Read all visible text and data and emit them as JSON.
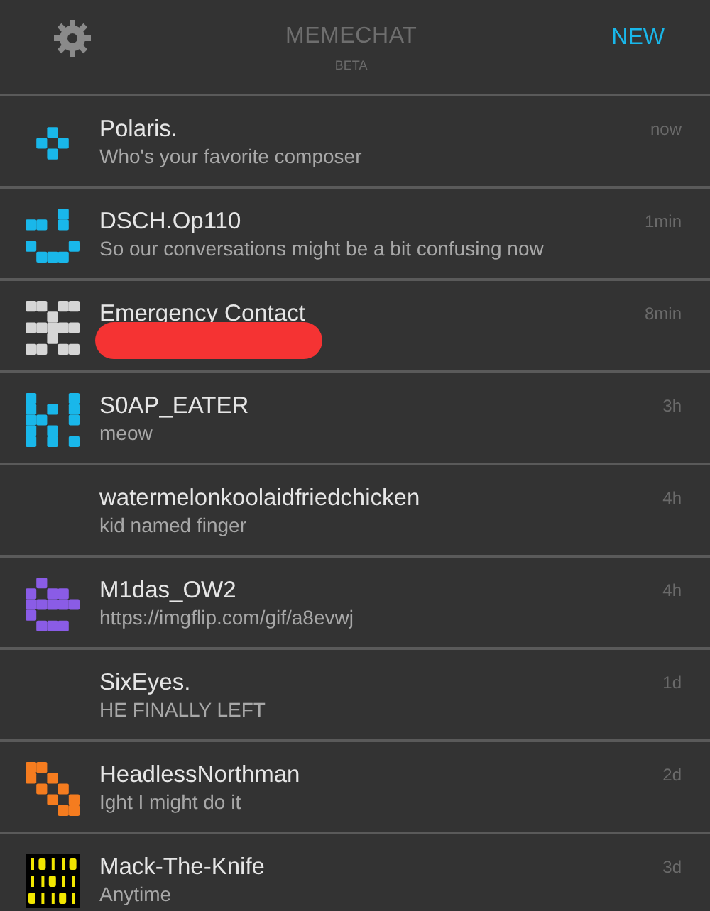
{
  "header": {
    "title": "MEMECHAT",
    "subtitle": "BETA",
    "new_button": "NEW"
  },
  "conversations": [
    {
      "name": "Polaris.",
      "preview": "Who's your favorite composer",
      "time": "now",
      "avatar": {
        "kind": "identicon",
        "color": "#19b7ea"
      }
    },
    {
      "name": "DSCH.Op110",
      "preview": "So our conversations might be a bit confusing now",
      "time": "1min",
      "avatar": {
        "kind": "identicon",
        "color": "#19b7ea"
      }
    },
    {
      "name": "Emergency Contact",
      "time": "8min",
      "redacted": true,
      "avatar": {
        "kind": "identicon",
        "color": "#d6d6d6"
      }
    },
    {
      "name": "S0AP_EATER",
      "preview": "meow",
      "time": "3h",
      "avatar": {
        "kind": "identicon",
        "color": "#19b7ea"
      }
    },
    {
      "name": "watermelonkoolaidfriedchicken",
      "preview": "kid named finger",
      "time": "4h"
    },
    {
      "name": "M1das_OW2",
      "preview": "https://imgflip.com/gif/a8evwj",
      "time": "4h",
      "avatar": {
        "kind": "identicon",
        "color": "#8a5ce6"
      }
    },
    {
      "name": "SixEyes.",
      "preview": "HE FINALLY LEFT",
      "time": "1d"
    },
    {
      "name": "HeadlessNorthman",
      "preview": "Ight I might do it",
      "time": "2d",
      "avatar": {
        "kind": "identicon",
        "color": "#f57c1f"
      }
    },
    {
      "name": "Mack-The-Knife",
      "preview": "Anytime",
      "time": "3d",
      "avatar": {
        "kind": "binary",
        "color": "#f2e600"
      }
    }
  ]
}
